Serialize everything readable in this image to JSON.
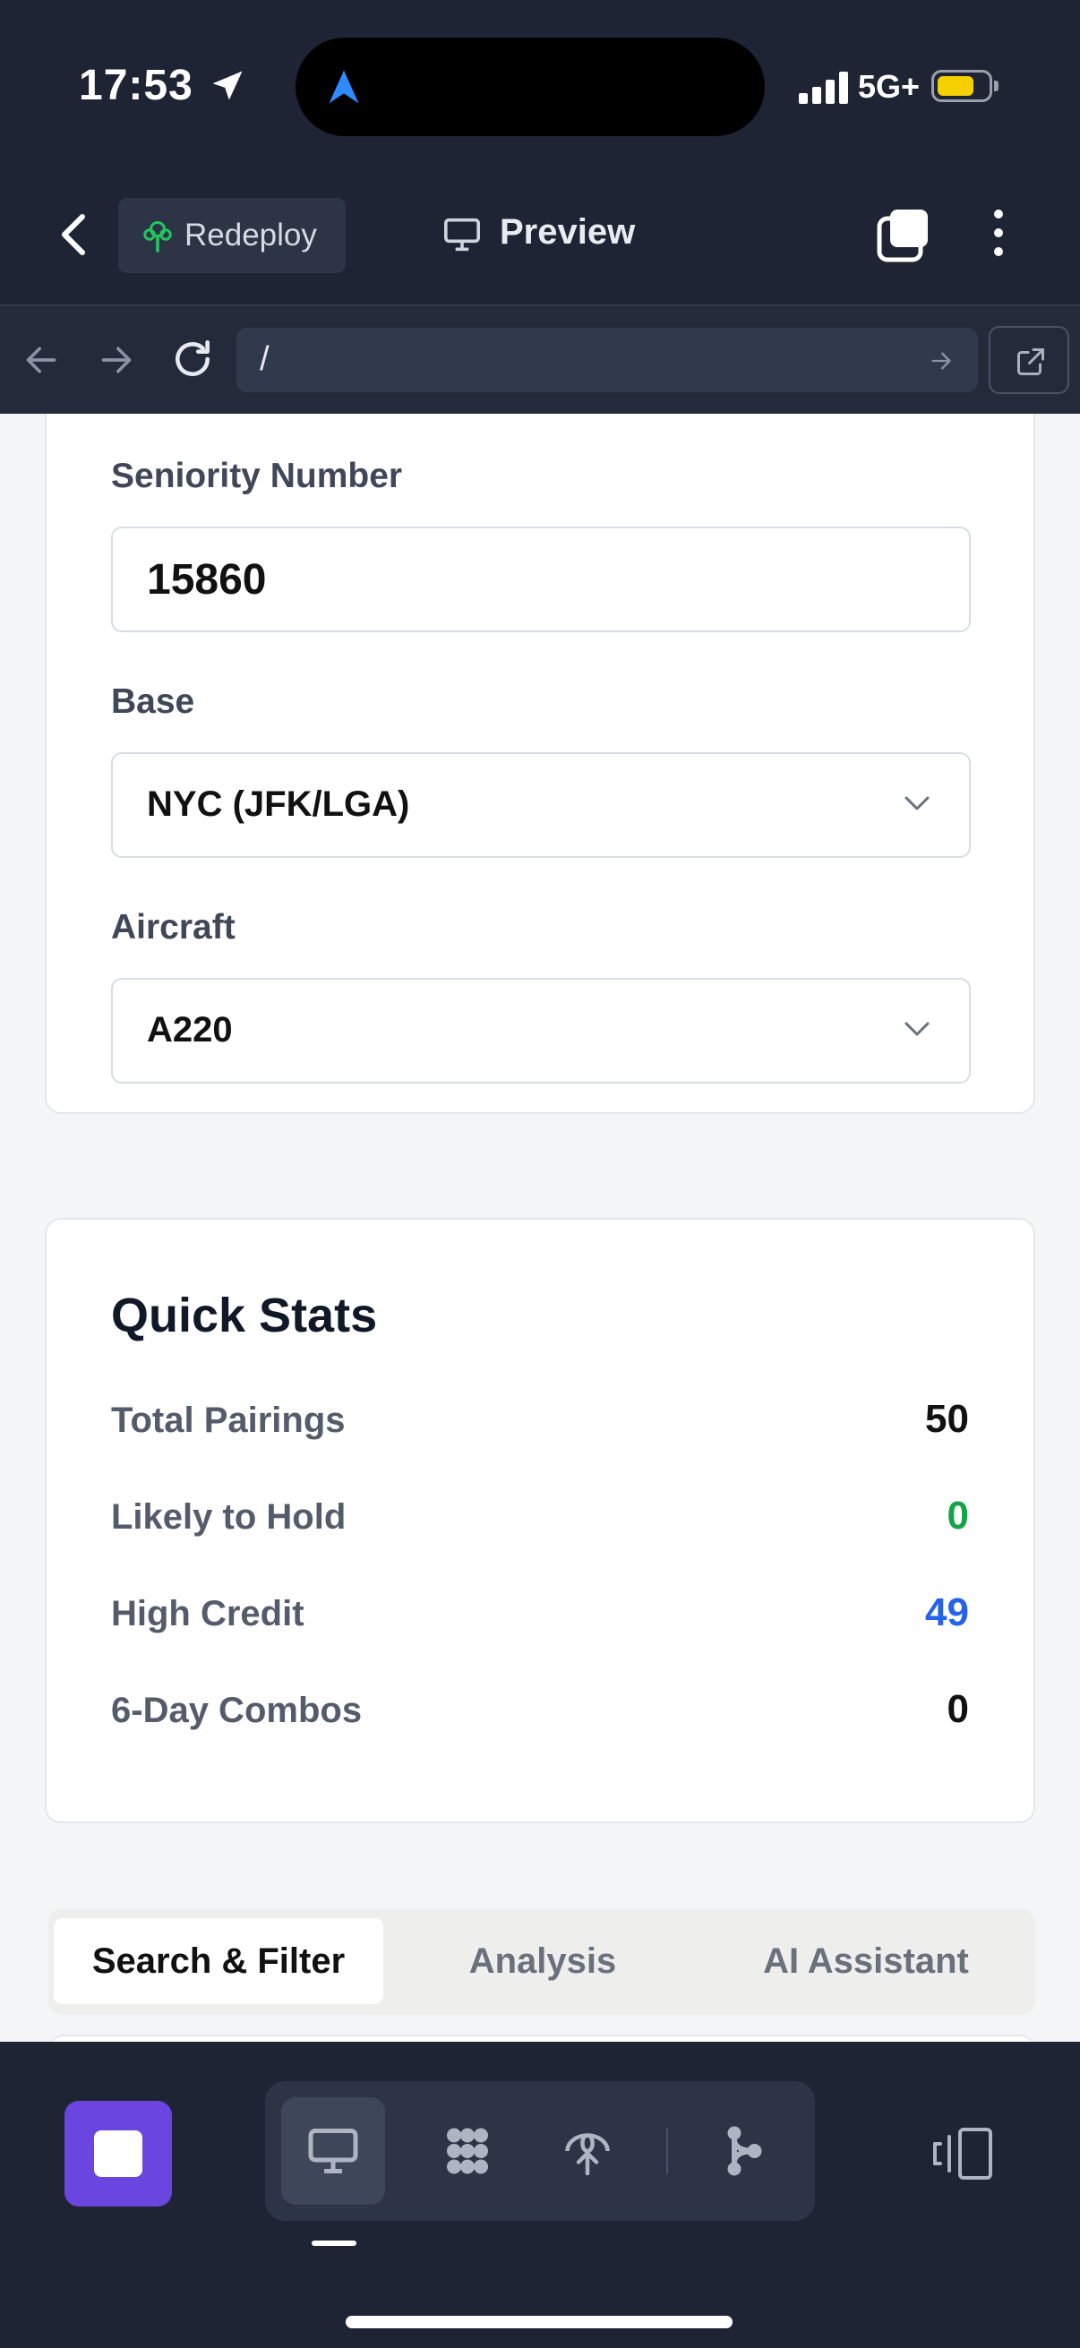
{
  "status_bar": {
    "time": "17:53",
    "network": "5G+",
    "battery_color": "#f5d000"
  },
  "header": {
    "redeploy_label": "Redeploy",
    "preview_label": "Preview"
  },
  "browser": {
    "url": "/"
  },
  "form": {
    "seniority_label": "Seniority Number",
    "seniority_value": "15860",
    "base_label": "Base",
    "base_value": "NYC (JFK/LGA)",
    "aircraft_label": "Aircraft",
    "aircraft_value": "A220"
  },
  "quick_stats": {
    "title": "Quick Stats",
    "items": [
      {
        "label": "Total Pairings",
        "value": "50",
        "color": "#111111"
      },
      {
        "label": "Likely to Hold",
        "value": "0",
        "color": "#16a34a"
      },
      {
        "label": "High Credit",
        "value": "49",
        "color": "#2563eb"
      },
      {
        "label": "6-Day Combos",
        "value": "0",
        "color": "#111111"
      }
    ]
  },
  "tabs": [
    {
      "label": "Search & Filter",
      "active": true
    },
    {
      "label": "Analysis",
      "active": false
    },
    {
      "label": "AI Assistant",
      "active": false
    }
  ],
  "colors": {
    "dark_bg": "#1e2433",
    "accent_purple": "#6a45e0",
    "redeploy_green": "#22c55e"
  },
  "icons": [
    "location-arrow-icon",
    "signal-icon",
    "battery-icon",
    "chevron-left-icon",
    "redeploy-tree-icon",
    "monitor-icon",
    "tabs-icon",
    "kebab-icon",
    "arrow-left-icon",
    "arrow-right-icon",
    "reload-icon",
    "external-link-icon",
    "chevron-down-icon",
    "stop-icon",
    "monitor-icon",
    "dots-grid-icon",
    "deploy-tree-icon",
    "branch-icon",
    "devices-icon"
  ]
}
